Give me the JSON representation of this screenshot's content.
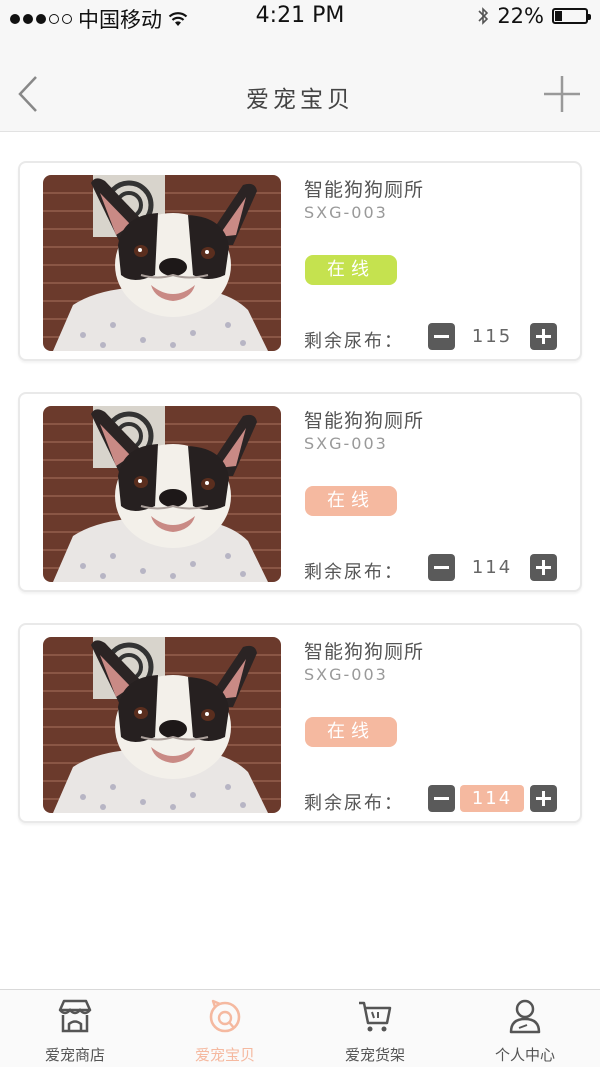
{
  "status_bar": {
    "carrier": "中国移动",
    "time": "4:21 PM",
    "battery": "22%",
    "battery_level": 0.22,
    "signal_bars": 3,
    "signal_total": 5,
    "icons": [
      "wifi-icon",
      "bluetooth-icon",
      "battery-icon"
    ]
  },
  "nav": {
    "title": "爱宠宝贝",
    "back_icon": "chevron-left-icon",
    "add_icon": "plus-icon"
  },
  "colors": {
    "online_active": "#c5e24f",
    "online_inactive": "#f5b9a0",
    "accent": "#f5b9a0",
    "stepper": "#5a5a5a"
  },
  "devices": [
    {
      "name": "智能狗狗厕所",
      "model": "SXG-003",
      "status": "在线",
      "status_color": "#c5e24f",
      "diaper_label": "剩余尿布：",
      "diaper_count": "115",
      "editing": false
    },
    {
      "name": "智能狗狗厕所",
      "model": "SXG-003",
      "status": "在线",
      "status_color": "#f5b9a0",
      "diaper_label": "剩余尿布：",
      "diaper_count": "114",
      "editing": false
    },
    {
      "name": "智能狗狗厕所",
      "model": "SXG-003",
      "status": "在线",
      "status_color": "#f5b9a0",
      "diaper_label": "剩余尿布：",
      "diaper_count": "114",
      "editing": true
    }
  ],
  "tabs": [
    {
      "label": "爱宠商店",
      "icon": "store-icon",
      "active": false
    },
    {
      "label": "爱宠宝贝",
      "icon": "pet-icon",
      "active": true
    },
    {
      "label": "爱宠货架",
      "icon": "cart-icon",
      "active": false
    },
    {
      "label": "个人中心",
      "icon": "person-icon",
      "active": false
    }
  ]
}
